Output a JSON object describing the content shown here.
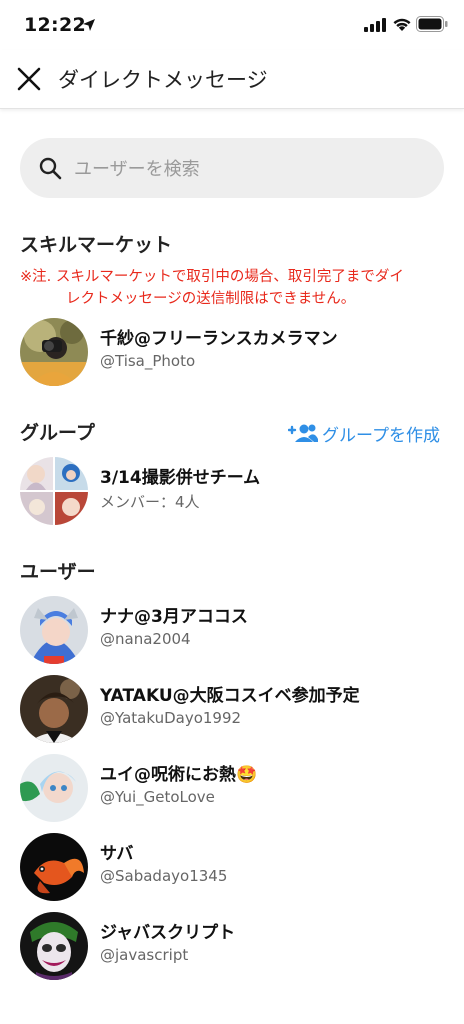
{
  "status_bar": {
    "time": "12:22"
  },
  "header": {
    "title": "ダイレクトメッセージ"
  },
  "search": {
    "placeholder": "ユーザーを検索"
  },
  "skill_market": {
    "title": "スキルマーケット",
    "notice_line1": "※注. スキルマーケットで取引中の場合、取引完了までダイ",
    "notice_line2": "レクトメッセージの送信制限はできません。",
    "notice_color": "#e8291c",
    "contact": {
      "name": "千紗@フリーランスカメラマン",
      "handle": "@Tisa_Photo"
    }
  },
  "groups": {
    "title": "グループ",
    "create_label": "グループを作成",
    "accent_color": "#2f8fe6",
    "items": [
      {
        "name": "3/14撮影併せチーム",
        "members": "メンバー：4人"
      }
    ]
  },
  "users": {
    "title": "ユーザー",
    "items": [
      {
        "name": "ナナ@3月アココス",
        "handle": "@nana2004"
      },
      {
        "name": "YATAKU@大阪コスイベ参加予定",
        "handle": "@YatakuDayo1992"
      },
      {
        "name": "ユイ@呪術にお熱🤩",
        "handle": "@Yui_GetoLove"
      },
      {
        "name": "サバ",
        "handle": "@Sabadayo1345"
      },
      {
        "name": "ジャバスクリプト",
        "handle": "@javascript"
      }
    ]
  }
}
